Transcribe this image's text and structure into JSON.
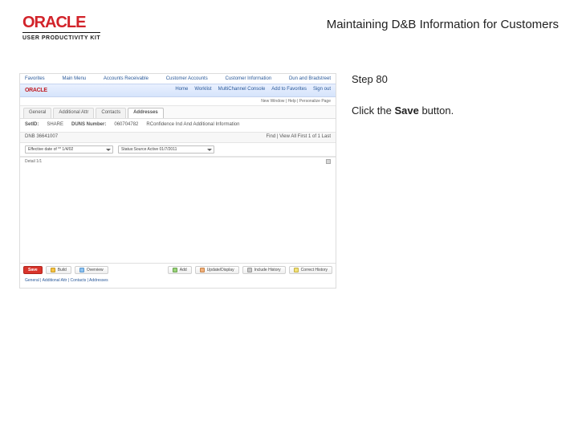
{
  "header": {
    "logo_text": "ORACLE",
    "upk_text": "USER PRODUCTIVITY KIT",
    "doc_title": "Maintaining D&B Information for Customers"
  },
  "right": {
    "step_label": "Step 80",
    "instr_pre": "Click the ",
    "instr_bold": "Save",
    "instr_post": " button."
  },
  "app": {
    "topnav": [
      "Favorites",
      "Main Menu",
      "Accounts Receivable",
      "Customer Accounts",
      "Customer Information",
      "Dun and Bradstreet"
    ],
    "brand": "ORACLE",
    "menu": [
      "Home",
      "Worklist",
      "MultiChannel Console",
      "Add to Favorites",
      "Sign out"
    ],
    "pager": "New Window | Help | Personalize Page",
    "tabs": [
      "General",
      "Additional Attr",
      "Contacts",
      "Addresses"
    ],
    "section": {
      "label1": "SetID:",
      "val1": "SHARE",
      "label2": "DUNS Number:",
      "val2": "060704782",
      "label3": "RConfidence Ind And Additional Information"
    },
    "subhead_left": "DNB 36641007",
    "subhead_right": "Find | View All    First   1 of 1   Last",
    "select1": "Effective date of ** 1/4/02",
    "select2": "Status:Source Active   01/7/2011",
    "canvas_label": "Detail 1/1",
    "buttons": {
      "save": "Save",
      "build": "Build",
      "overview": "Overview",
      "add": "Add",
      "update": "Update/Display",
      "include": "Include History",
      "correct": "Correct History"
    },
    "footer_links": "General | Additional Attr | Contacts | Addresses"
  }
}
